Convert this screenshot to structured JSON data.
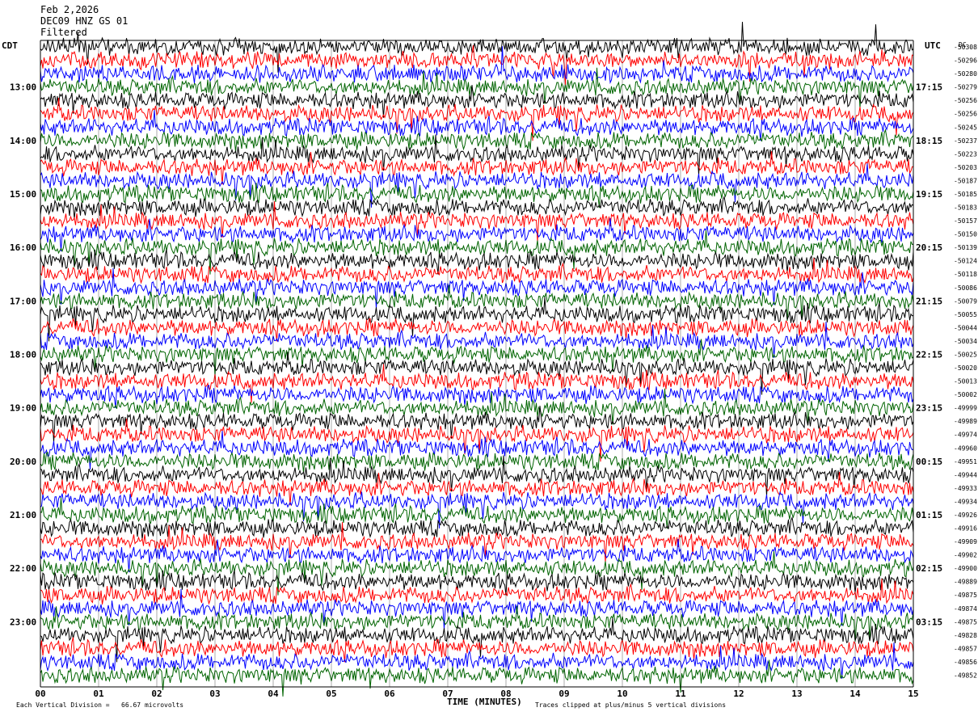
{
  "header": {
    "date": "Feb 2,2026",
    "station": "DEC09 HNZ GS 01",
    "filter": "Filtered"
  },
  "left_unit": "CDT",
  "right_unit": "UTC",
  "dc_label": "DC",
  "footer": {
    "vertical_division": "Each Vertical Division =   66.67 microvolts",
    "x_title": "TIME (MINUTES)",
    "clip_note": "Traces clipped at plus/minus 5 vertical divisions"
  },
  "chart_data": {
    "type": "line",
    "title": "",
    "xlabel": "TIME (MINUTES)",
    "xlim": [
      0,
      15
    ],
    "x_ticks": [
      "00",
      "01",
      "02",
      "03",
      "04",
      "05",
      "06",
      "07",
      "08",
      "09",
      "10",
      "11",
      "12",
      "13",
      "14",
      "15"
    ],
    "left_time_ticks": [
      "13:00",
      "14:00",
      "15:00",
      "16:00",
      "17:00",
      "18:00",
      "19:00",
      "20:00",
      "21:00",
      "22:00",
      "23:00"
    ],
    "right_time_ticks": [
      "17:15",
      "18:15",
      "19:15",
      "20:15",
      "21:15",
      "22:15",
      "23:15",
      "00:15",
      "01:15",
      "02:15",
      "03:15"
    ],
    "trace_colors": [
      "#000000",
      "#ff0000",
      "#0000ff",
      "#006400"
    ],
    "trace_count": 48,
    "dc_offsets": [
      "-50308",
      "-50296",
      "-50280",
      "-50279",
      "-50256",
      "-50256",
      "-50245",
      "-50237",
      "-50223",
      "-50203",
      "-50187",
      "-50185",
      "-50183",
      "-50157",
      "-50150",
      "-50139",
      "-50124",
      "-50118",
      "-50086",
      "-50079",
      "-50055",
      "-50044",
      "-50034",
      "-50025",
      "-50020",
      "-50013",
      "-50002",
      "-49999",
      "-49989",
      "-49974",
      "-49960",
      "-49951",
      "-49944",
      "-49933",
      "-49934",
      "-49926",
      "-49916",
      "-49909",
      "-49902",
      "-49900",
      "-49889",
      "-49875",
      "-49874",
      "-49875",
      "-49828",
      "-49857",
      "-49856",
      "-49852"
    ],
    "clip_divisions": 5,
    "microvolts_per_division": 66.67
  }
}
